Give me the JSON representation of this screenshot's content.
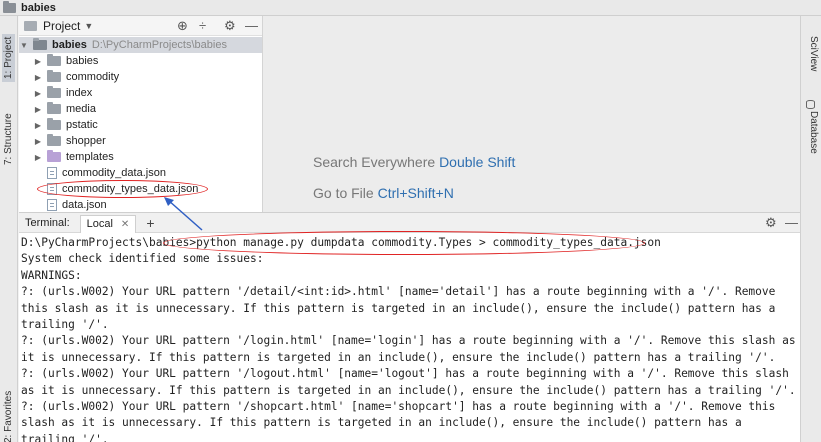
{
  "window": {
    "title": "babies"
  },
  "left_strip": {
    "project_tab": "1: Project",
    "structure_tab": "7: Structure",
    "favorites_tab": "2: Favorites"
  },
  "right_strip": {
    "sciview_tab": "SciView",
    "database_tab": "Database"
  },
  "project_panel": {
    "header_title": "Project",
    "root": {
      "name": "babies",
      "path": "D:\\PyCharmProjects\\babies"
    },
    "folders": [
      {
        "label": "babies"
      },
      {
        "label": "commodity"
      },
      {
        "label": "index"
      },
      {
        "label": "media"
      },
      {
        "label": "pstatic"
      },
      {
        "label": "shopper"
      },
      {
        "label": "templates"
      }
    ],
    "files": [
      {
        "label": "commodity_data.json"
      },
      {
        "label": "commodity_types_data.json"
      },
      {
        "label": "data.json"
      }
    ]
  },
  "editor": {
    "hint1_text": "Search Everywhere",
    "hint1_key": "Double Shift",
    "hint2_text": "Go to File",
    "hint2_key": "Ctrl+Shift+N"
  },
  "terminal_bar": {
    "label": "Terminal:",
    "tab": "Local"
  },
  "terminal": {
    "lines": [
      "D:\\PyCharmProjects\\babies>python manage.py dumpdata commodity.Types > commodity_types_data.json",
      "System check identified some issues:",
      "",
      "WARNINGS:",
      "?: (urls.W002) Your URL pattern '/detail/<int:id>.html' [name='detail'] has a route beginning with a '/'. Remove this slash as it is unnecessary. If this pattern is targeted in an include(), ensure the include() pattern has a trailing '/'.",
      "?: (urls.W002) Your URL pattern '/login.html' [name='login'] has a route beginning with a '/'. Remove this slash as it is unnecessary. If this pattern is targeted in an include(), ensure the include() pattern has a trailing '/'.",
      "?: (urls.W002) Your URL pattern '/logout.html' [name='logout'] has a route beginning with a '/'. Remove this slash as it is unnecessary. If this pattern is targeted in an include(), ensure the include() pattern has a trailing '/'.",
      "?: (urls.W002) Your URL pattern '/shopcart.html' [name='shopcart'] has a route beginning with a '/'. Remove this slash as it is unnecessary. If this pattern is targeted in an include(), ensure the include() pattern has a trailing '/'."
    ]
  },
  "icons": {
    "locate": "crosshair-icon",
    "collapse": "collapse-all-icon",
    "settings": "gear-icon",
    "hide": "minimize-icon"
  },
  "colors": {
    "annotation": "#e02424",
    "arrow": "#2f5fc4",
    "shortcut": "#2f6fb0"
  }
}
